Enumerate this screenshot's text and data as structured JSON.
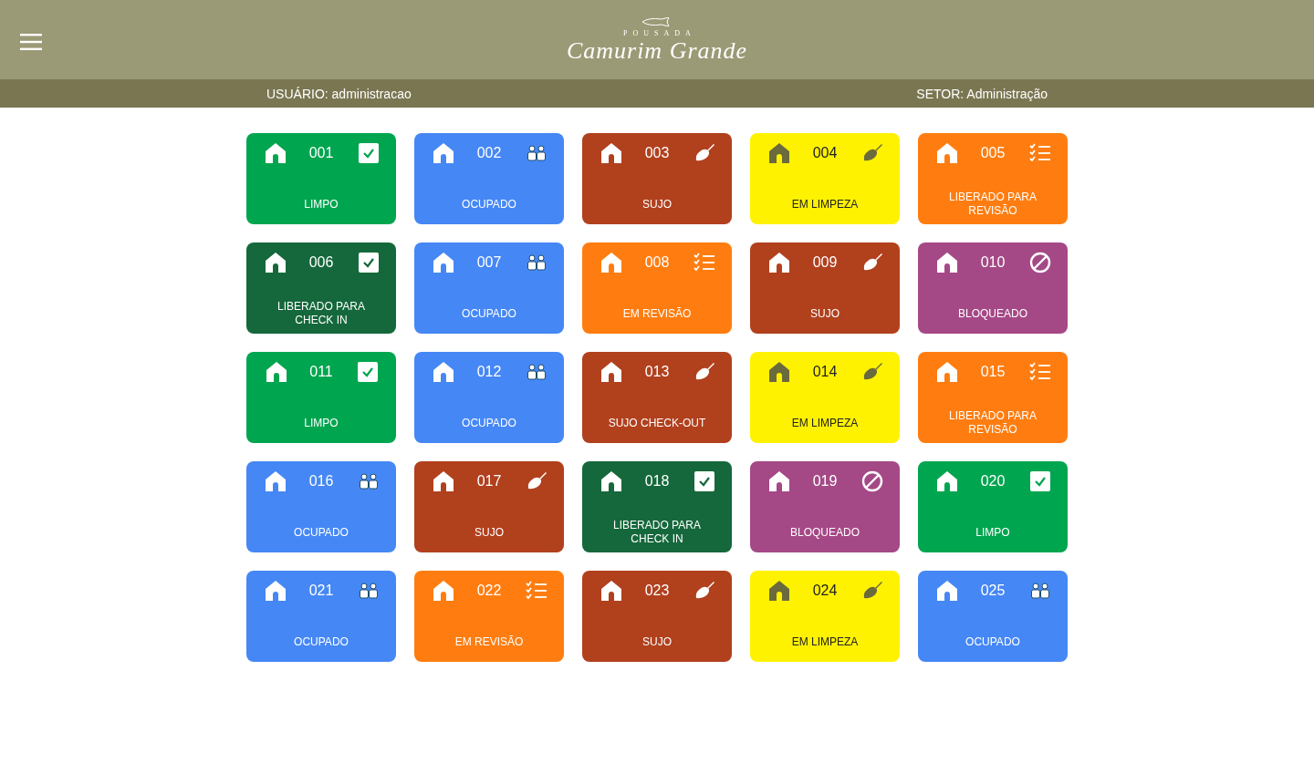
{
  "header": {
    "logo_small": "POUSADA",
    "logo_main": "Camurim Grande"
  },
  "user_bar": {
    "user": "USUÁRIO: administracao",
    "sector": "SETOR: Administração"
  },
  "rooms": [
    {
      "number": "001",
      "status": "LIMPO",
      "kind": "clean"
    },
    {
      "number": "002",
      "status": "OCUPADO",
      "kind": "occupied"
    },
    {
      "number": "003",
      "status": "SUJO",
      "kind": "dirty"
    },
    {
      "number": "004",
      "status": "EM LIMPEZA",
      "kind": "cleaning"
    },
    {
      "number": "005",
      "status": "LIBERADO PARA REVISÃO",
      "kind": "review"
    },
    {
      "number": "006",
      "status": "LIBERADO PARA CHECK IN",
      "kind": "checkin"
    },
    {
      "number": "007",
      "status": "OCUPADO",
      "kind": "occupied"
    },
    {
      "number": "008",
      "status": "EM REVISÃO",
      "kind": "review"
    },
    {
      "number": "009",
      "status": "SUJO",
      "kind": "dirty"
    },
    {
      "number": "010",
      "status": "BLOQUEADO",
      "kind": "blocked"
    },
    {
      "number": "011",
      "status": "LIMPO",
      "kind": "clean"
    },
    {
      "number": "012",
      "status": "OCUPADO",
      "kind": "occupied"
    },
    {
      "number": "013",
      "status": "SUJO CHECK-OUT",
      "kind": "dirty"
    },
    {
      "number": "014",
      "status": "EM LIMPEZA",
      "kind": "cleaning"
    },
    {
      "number": "015",
      "status": "LIBERADO PARA REVISÃO",
      "kind": "review"
    },
    {
      "number": "016",
      "status": "OCUPADO",
      "kind": "occupied"
    },
    {
      "number": "017",
      "status": "SUJO",
      "kind": "dirty"
    },
    {
      "number": "018",
      "status": "LIBERADO PARA CHECK IN",
      "kind": "checkin"
    },
    {
      "number": "019",
      "status": "BLOQUEADO",
      "kind": "blocked"
    },
    {
      "number": "020",
      "status": "LIMPO",
      "kind": "clean"
    },
    {
      "number": "021",
      "status": "OCUPADO",
      "kind": "occupied"
    },
    {
      "number": "022",
      "status": "EM REVISÃO",
      "kind": "review"
    },
    {
      "number": "023",
      "status": "SUJO",
      "kind": "dirty"
    },
    {
      "number": "024",
      "status": "EM LIMPEZA",
      "kind": "cleaning"
    },
    {
      "number": "025",
      "status": "OCUPADO",
      "kind": "occupied"
    }
  ]
}
